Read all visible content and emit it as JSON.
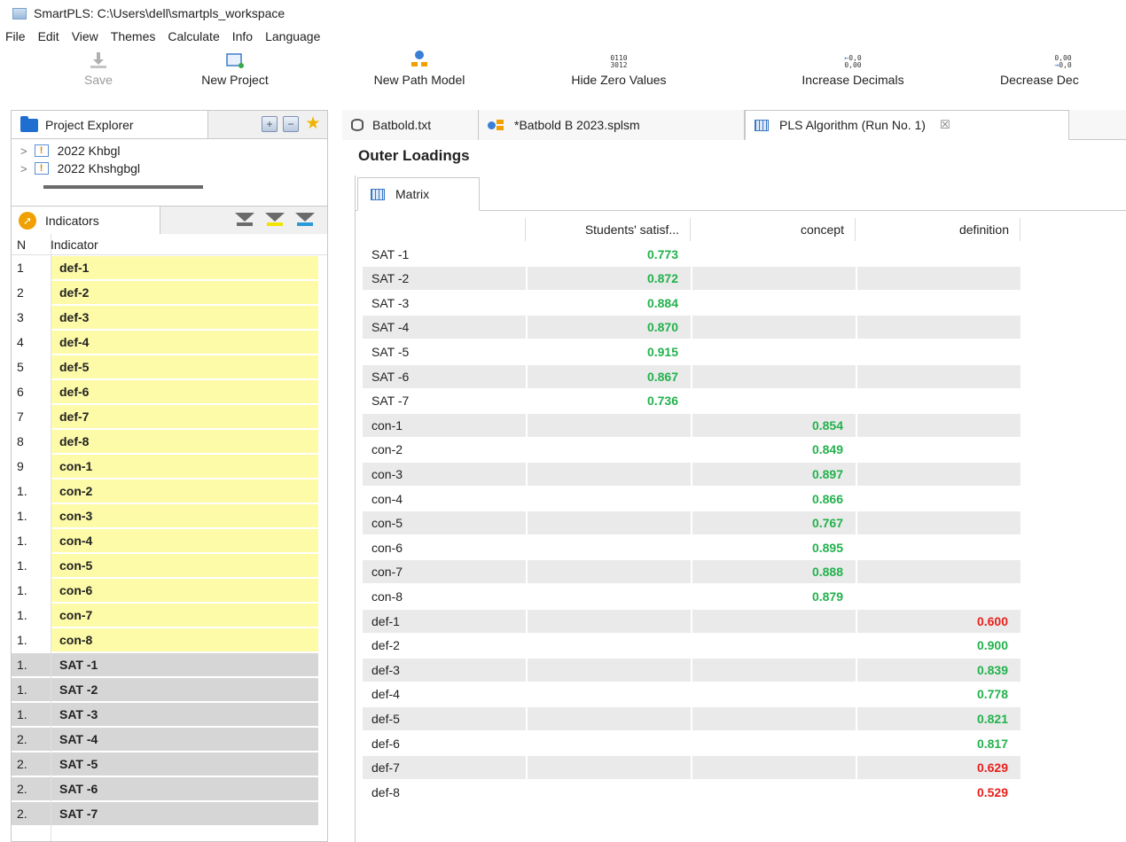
{
  "app": {
    "title": "SmartPLS: C:\\Users\\dell\\smartpls_workspace",
    "menu": [
      "File",
      "Edit",
      "View",
      "Themes",
      "Calculate",
      "Info",
      "Language"
    ]
  },
  "toolbar": {
    "save": "Save",
    "new_project": "New Project",
    "new_path_model": "New Path Model",
    "hide_zero": "Hide Zero Values",
    "hide_zero_glyph_top": "0110",
    "hide_zero_glyph_bottom": "3012",
    "increase_decimals": "Increase Decimals",
    "decrease_decimals": "Decrease Dec",
    "dec_glyph_top": "0,0",
    "dec_glyph_bottom": "0,00",
    "dec2_glyph_top": "0,00",
    "dec2_glyph_bottom": "0,0"
  },
  "project_explorer": {
    "tab_label": "Project Explorer",
    "items": [
      "2022 Khbgl",
      "2022 Khshgbgl"
    ]
  },
  "indicators": {
    "tab_label": "Indicators",
    "header_n": "N",
    "header_indicator": "Indicator",
    "rows": [
      {
        "n": "1",
        "name": "def-1",
        "style": "y"
      },
      {
        "n": "2",
        "name": "def-2",
        "style": "y"
      },
      {
        "n": "3",
        "name": "def-3",
        "style": "y"
      },
      {
        "n": "4",
        "name": "def-4",
        "style": "y"
      },
      {
        "n": "5",
        "name": "def-5",
        "style": "y"
      },
      {
        "n": "6",
        "name": "def-6",
        "style": "y"
      },
      {
        "n": "7",
        "name": "def-7",
        "style": "y"
      },
      {
        "n": "8",
        "name": "def-8",
        "style": "y"
      },
      {
        "n": "9",
        "name": "con-1",
        "style": "y"
      },
      {
        "n": "1.",
        "name": "con-2",
        "style": "y"
      },
      {
        "n": "1.",
        "name": "con-3",
        "style": "y"
      },
      {
        "n": "1.",
        "name": "con-4",
        "style": "y"
      },
      {
        "n": "1.",
        "name": "con-5",
        "style": "y"
      },
      {
        "n": "1.",
        "name": "con-6",
        "style": "y"
      },
      {
        "n": "1.",
        "name": "con-7",
        "style": "y"
      },
      {
        "n": "1.",
        "name": "con-8",
        "style": "y"
      },
      {
        "n": "1.",
        "name": "SAT -1",
        "style": "g"
      },
      {
        "n": "1.",
        "name": "SAT -2",
        "style": "g"
      },
      {
        "n": "1.",
        "name": "SAT -3",
        "style": "g"
      },
      {
        "n": "2.",
        "name": "SAT -4",
        "style": "g"
      },
      {
        "n": "2.",
        "name": "SAT -5",
        "style": "g"
      },
      {
        "n": "2.",
        "name": "SAT -6",
        "style": "g"
      },
      {
        "n": "2.",
        "name": "SAT -7",
        "style": "g"
      }
    ]
  },
  "editor_tabs": [
    {
      "label": "Batbold.txt",
      "icon": "database-icon"
    },
    {
      "label": "*Batbold B 2023.splsm",
      "icon": "path-model-icon"
    },
    {
      "label": "PLS Algorithm (Run No. 1)",
      "icon": "matrix-grid-icon"
    }
  ],
  "close_glyph": "☒",
  "section_title": "Outer Loadings",
  "matrix_tab": "Matrix",
  "matrix": {
    "columns": [
      "Students' satisf...",
      "concept",
      "definition"
    ],
    "rows": [
      {
        "label": "SAT -1",
        "col": 0,
        "value": "0.773",
        "status": "ok"
      },
      {
        "label": "SAT -2",
        "col": 0,
        "value": "0.872",
        "status": "ok"
      },
      {
        "label": "SAT -3",
        "col": 0,
        "value": "0.884",
        "status": "ok"
      },
      {
        "label": "SAT -4",
        "col": 0,
        "value": "0.870",
        "status": "ok"
      },
      {
        "label": "SAT -5",
        "col": 0,
        "value": "0.915",
        "status": "ok"
      },
      {
        "label": "SAT -6",
        "col": 0,
        "value": "0.867",
        "status": "ok"
      },
      {
        "label": "SAT -7",
        "col": 0,
        "value": "0.736",
        "status": "ok"
      },
      {
        "label": "con-1",
        "col": 1,
        "value": "0.854",
        "status": "ok"
      },
      {
        "label": "con-2",
        "col": 1,
        "value": "0.849",
        "status": "ok"
      },
      {
        "label": "con-3",
        "col": 1,
        "value": "0.897",
        "status": "ok"
      },
      {
        "label": "con-4",
        "col": 1,
        "value": "0.866",
        "status": "ok"
      },
      {
        "label": "con-5",
        "col": 1,
        "value": "0.767",
        "status": "ok"
      },
      {
        "label": "con-6",
        "col": 1,
        "value": "0.895",
        "status": "ok"
      },
      {
        "label": "con-7",
        "col": 1,
        "value": "0.888",
        "status": "ok"
      },
      {
        "label": "con-8",
        "col": 1,
        "value": "0.879",
        "status": "ok"
      },
      {
        "label": "def-1",
        "col": 2,
        "value": "0.600",
        "status": "bad"
      },
      {
        "label": "def-2",
        "col": 2,
        "value": "0.900",
        "status": "ok"
      },
      {
        "label": "def-3",
        "col": 2,
        "value": "0.839",
        "status": "ok"
      },
      {
        "label": "def-4",
        "col": 2,
        "value": "0.778",
        "status": "ok"
      },
      {
        "label": "def-5",
        "col": 2,
        "value": "0.821",
        "status": "ok"
      },
      {
        "label": "def-6",
        "col": 2,
        "value": "0.817",
        "status": "ok"
      },
      {
        "label": "def-7",
        "col": 2,
        "value": "0.629",
        "status": "bad"
      },
      {
        "label": "def-8",
        "col": 2,
        "value": "0.529",
        "status": "bad"
      }
    ]
  },
  "colors": {
    "ok": "#22b24c",
    "bad": "#e8201c",
    "indicator_yellow": "#fdfaa8",
    "indicator_gray": "#d6d6d6",
    "row_shade": "#eaeaea"
  }
}
